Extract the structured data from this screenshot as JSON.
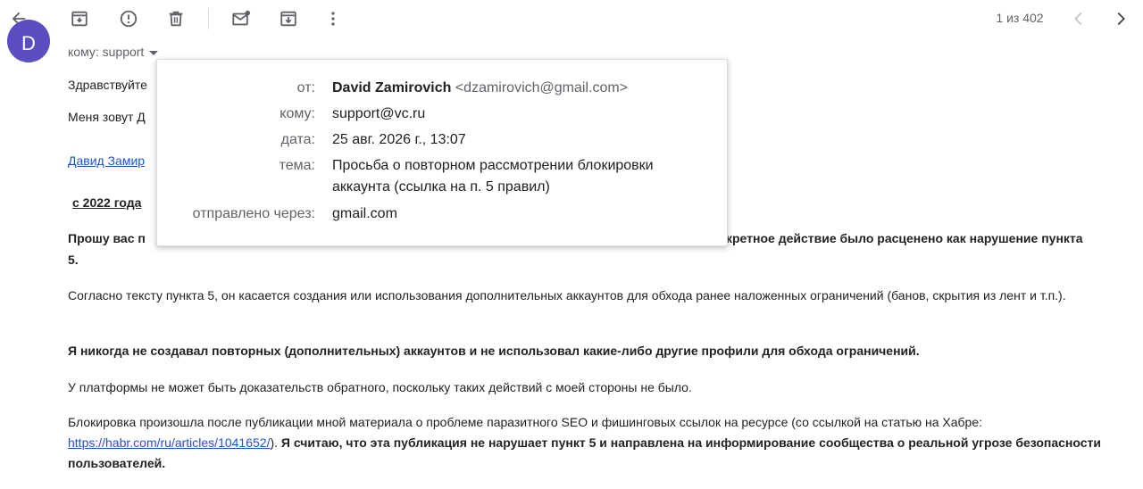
{
  "toolbar": {
    "icons": [
      "back-arrow-icon",
      "archive-icon",
      "report-spam-icon",
      "delete-icon",
      "mark-unread-icon",
      "move-to-icon",
      "more-vert-icon",
      "prev-chevron-icon",
      "next-chevron-icon"
    ],
    "counter": "1 из 402"
  },
  "avatar": {
    "letter": "D",
    "color": "#5b4ec1"
  },
  "recipient_line": "кому: support",
  "body": {
    "greeting": "Здравствуйте",
    "intro": "Меня зовут Д",
    "link1": "Давид Замир",
    "since": "с 2022 года",
    "request_part1": "Прошу вас п",
    "request_part2": "кретное действие было расценено как нарушение пункта",
    "request_part3": "5.",
    "para_rule": "Согласно тексту пункта 5, он касается создания или использования дополнительных аккаунтов для обхода ранее наложенных ограничений (банов, скрытия из лент и т.п.).",
    "para_never": "Я никогда не создавал повторных (дополнительных) аккаунтов и не использовал какие-либо другие профили для обхода ограничений.",
    "para_evidence": "У платформы не может быть доказательств обратного, поскольку таких действий с моей стороны не было.",
    "para_block_prefix": "Блокировка произошла после публикации мной материала о проблеме паразитного SEO и фишинговых ссылок на ресурсе (со ссылкой на статью на Хабре: ",
    "habr_link": "https://habr.com/ru/articles/1041652/",
    "para_block_mid": "). ",
    "para_block_bold": "Я считаю, что эта публикация не нарушает пункт 5 и направлена на информирование сообщества о реальной угрозе безопасности пользователей."
  },
  "details_popup": {
    "from_label": "от:",
    "from_name": "David Zamirovich",
    "from_email": "<dzamirovich@gmail.com>",
    "to_label": "кому:",
    "to_value": "support@vc.ru",
    "date_label": "дата:",
    "date_value": "25 авг. 2026 г., 13:07",
    "subject_label": "тема:",
    "subject_value": "Просьба о повторном рассмотрении блокировки аккаунта (ссылка на п. 5 правил)",
    "via_label": "отправлено через:",
    "via_value": "gmail.com"
  }
}
